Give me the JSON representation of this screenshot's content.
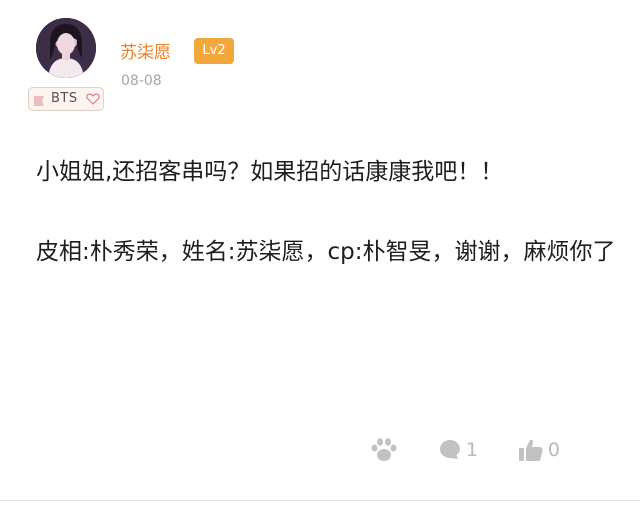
{
  "post": {
    "author": {
      "name": "苏柒愿",
      "level": "Lv2",
      "fan_badge": "BTS",
      "date": "08-08"
    },
    "content": {
      "paragraph_1": "小姐姐,还招客串吗？如果招的话康康我吧！！",
      "paragraph_2": "皮相:朴秀荣，姓名:苏柒愿，cp:朴智旻，谢谢，麻烦你了"
    },
    "actions": {
      "paw_icon": "paw-icon",
      "comment_count": "1",
      "like_count": "0"
    }
  },
  "colors": {
    "username": "#e8802a",
    "level_badge": "#f2a73b",
    "muted": "#a6a6a6",
    "icon": "#c2c2c2"
  }
}
